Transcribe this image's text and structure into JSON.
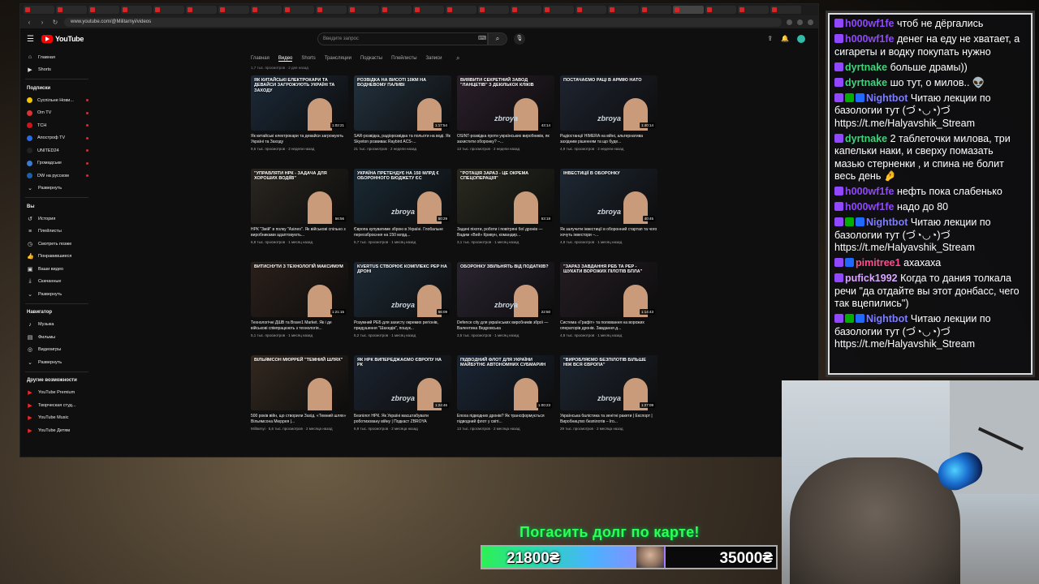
{
  "browser": {
    "url": "www.youtube.com/@Militarnyi/videos"
  },
  "youtube": {
    "logo_text": "YouTube",
    "search_placeholder": "Введите запрос",
    "sidebar": {
      "main": [
        {
          "label": "Главная",
          "icon": "home-icon"
        },
        {
          "label": "Shorts",
          "icon": "shorts-icon"
        }
      ],
      "subs_header": "Подписки",
      "subs": [
        {
          "label": "Суспільне Нови...",
          "color": "#f5c400"
        },
        {
          "label": "Om TV",
          "color": "#e03030"
        },
        {
          "label": "ТСН",
          "color": "#d01515"
        },
        {
          "label": "Апостроф TV",
          "color": "#2a6be0"
        },
        {
          "label": "UNITED24",
          "color": "#222222"
        },
        {
          "label": "Громадське",
          "color": "#3a7bd5"
        },
        {
          "label": "DW на русском",
          "color": "#1d5fa8"
        }
      ],
      "expand1": "Развернуть",
      "you_header": "Вы",
      "you": [
        {
          "label": "История",
          "icon": "history-icon"
        },
        {
          "label": "Плейлисты",
          "icon": "playlist-icon"
        },
        {
          "label": "Смотреть позже",
          "icon": "clock-icon"
        },
        {
          "label": "Понравившиеся",
          "icon": "like-icon"
        },
        {
          "label": "Ваши видео",
          "icon": "video-icon"
        },
        {
          "label": "Скачанные",
          "icon": "download-icon"
        },
        {
          "label": "Развернуть",
          "icon": "chevron-down-icon"
        }
      ],
      "nav_header": "Навигатор",
      "nav": [
        {
          "label": "Музыка",
          "icon": "music-icon"
        },
        {
          "label": "Фильмы",
          "icon": "film-icon"
        },
        {
          "label": "Видеоигры",
          "icon": "gamepad-icon"
        },
        {
          "label": "Развернуть",
          "icon": "chevron-down-icon"
        }
      ],
      "more_header": "Другие возможности",
      "more": [
        {
          "label": "YouTube Premium"
        },
        {
          "label": "Творческая студ..."
        },
        {
          "label": "YouTube Music"
        },
        {
          "label": "YouTube Детям"
        }
      ]
    },
    "channel_tabs": [
      "Главная",
      "Видео",
      "Shorts",
      "Трансляции",
      "Подкасты",
      "Плейлисты",
      "Записи"
    ],
    "prev_row_meta": [
      "1,7 тыс. просмотров · 2 дня назад",
      "",
      "",
      ""
    ],
    "rows": [
      [
        {
          "headline": "Як китайські електрокари та девайси загрожують Україні та Заходу",
          "dur": "1:02:21",
          "bg": "#1c2a3a",
          "title": "Як китайські електрокари та девайси загрожують Україні та Заходу",
          "meta": "9,6 тыс. просмотров · 2 недели назад"
        },
        {
          "headline": "Розвідка на висоті 10км на водневому паливі",
          "dur": "1:17:54",
          "bg": "#23323f",
          "title": "SAR-розвідка, радіорозвідка та польоти на воді. Як Skyeton розвиває Raybird ACS-...",
          "meta": "21 тыс. просмотров · 2 недели назад"
        },
        {
          "headline": "Виявити секретний завод \"ланцетів\" з декількох кліків",
          "dur": "43:14",
          "bg": "#2a1e2a",
          "brand": "zbroya",
          "title": "OSINT-розвідка проти українських виробників, як захистити оборонку? –...",
          "meta": "13 тыс. просмотров · 2 недели назад"
        },
        {
          "headline": "Постачаємо раці в армію НАТО",
          "dur": "1:40:14",
          "bg": "#1e2430",
          "brand": "zbroya",
          "title": "Радіостанції HIMERA на війні, альтернатива західним рішенням та що буде...",
          "meta": "4,9 тыс. просмотров · 2 недели назад"
        }
      ],
      [
        {
          "headline": "\"Управляти НРК - задача для хороших водіїв\"",
          "dur": "56:56",
          "bg": "#2b2620",
          "title": "НРК \"Змій\" в полку \"Азілео\". Як військові спільно з виробниками адаптовують...",
          "meta": "6,8 тыс. просмотров · 1 месяц назад"
        },
        {
          "headline": "Україна претендує на 150 млрд € оборонного бюджету ЄС",
          "dur": "50:29",
          "bg": "#1a2a35",
          "brand": "zbroya",
          "title": "Європа купуватиме зброю в Україні. Глобальне переозброєння на 150 млрд...",
          "meta": "5,7 тыс. просмотров · 1 месяц назад"
        },
        {
          "headline": "\"Ротація зараз - це окрема спецоперація\"",
          "dur": "53:18",
          "bg": "#2a2a20",
          "title": "Задачі піхоти, роботи і повітряні бої дронів — Вадим «Вей» Кривун, командир...",
          "meta": "3,1 тыс. просмотров · 1 месяц назад"
        },
        {
          "headline": "Інвестиції в оборонку",
          "dur": "40:45",
          "bg": "#1e2834",
          "brand": "zbroya",
          "title": "Як залучити інвестиції в оборонний стартап та чого хочуть інвестори –...",
          "meta": "4,8 тыс. просмотров · 1 месяц назад"
        }
      ],
      [
        {
          "headline": "Витиснути з технологій максимум",
          "dur": "1:21:15",
          "bg": "#2b1f1a",
          "title": "Технологічні ДШВ та Brave1 Market. Як і де військові співпрацюють з технологія...",
          "meta": "5,1 тыс. просмотров · 1 месяц назад"
        },
        {
          "headline": "Kvertus створює комплекс РЕР на дроні",
          "dur": "56:09",
          "bg": "#1d2a36",
          "brand": "zbroya",
          "title": "Розумний РЕБ для захисту окремих регіонів, придушення \"Шахедів\", пошук...",
          "meta": "5,2 тыс. просмотров · 1 месяц назад"
        },
        {
          "headline": "Оборонку звільнять від податків?",
          "dur": "22:50",
          "bg": "#2a2430",
          "brand": "zbroya",
          "title": "Defence city для українських виробників зброї — Валентина Ведровська",
          "meta": "3,5 тыс. просмотров · 1 месяц назад"
        },
        {
          "headline": "\"Зараз завдання РЕБ та РЕР - шукати ворожих пілотів БпЛА\"",
          "dur": "1:14:43",
          "bg": "#241c22",
          "title": "Система «Графіт» та полювання на ворожих операторів дронів. Завдання д...",
          "meta": "4,8 тыс. просмотров · 1 месяц назад"
        }
      ],
      [
        {
          "headline": "Вільямсон Мюррей \"Темний шлях\"",
          "dur": "",
          "bg": "#33281f",
          "title": "500 років війн, що створили Захід. «Темний шлях» Вільямсона Мюррея |...",
          "meta": "Militarnyi · 5,6 тыс. просмотров · 2 месяца назад"
        },
        {
          "headline": "Як НРК випереджаємо Європу на РК",
          "dur": "1:24:46",
          "bg": "#1c2430",
          "brand": "zbroya",
          "title": "Безпілот НРК. Як Україні масштабувати роботизовану війну | Подкаст ZBROYA",
          "meta": "6,9 тыс. просмотров · 2 месяца назад"
        },
        {
          "headline": "Підводний флот для України майбутнє автономних субмарин",
          "dur": "1:00:23",
          "bg": "#1a2636",
          "title": "Епоха підводних дронів? Як трансформується підводний флот у світі...",
          "meta": "13 тыс. просмотров · 2 месяца назад"
        },
        {
          "headline": "\"Виробляємо безпілотів більше ніж вся Європа\"",
          "dur": "1:27:09",
          "bg": "#1e2632",
          "brand": "zbroya",
          "title": "Українська балістика та зенітні ракети | Експорт | Виробництво безпілотів – Іго...",
          "meta": "29 тыс. просмотров · 2 месяца назад"
        }
      ]
    ]
  },
  "chat": [
    {
      "user": "h000wf1fe",
      "color": "#9146ff",
      "badges": [
        "b-purple"
      ],
      "text": "чтоб не дёргались"
    },
    {
      "user": "h000wf1fe",
      "color": "#9146ff",
      "badges": [
        "b-purple"
      ],
      "text": "денег на еду не хватает, а сигареты и водку покупать нужно"
    },
    {
      "user": "dyrtnake",
      "color": "#3cd67a",
      "badges": [
        "b-purple"
      ],
      "text": "больше драмы))"
    },
    {
      "user": "dyrtnake",
      "color": "#3cd67a",
      "badges": [
        "b-purple"
      ],
      "text": "шо тут, о милов.. 👽"
    },
    {
      "user": "Nightbot",
      "color": "#7c7cff",
      "badges": [
        "b-purple",
        "b-green",
        "b-blue"
      ],
      "text": "Читаю лекции по базологии тут (づ◔◡◔)づ https://t.me/Halyavshik_Stream"
    },
    {
      "user": "dyrtnake",
      "color": "#3cd67a",
      "badges": [
        "b-purple"
      ],
      "text": "2 таблеточки милова, три капельки наки, и сверху помазать мазью стерненки , и спина не болит весь день 🤌"
    },
    {
      "user": "h000wf1fe",
      "color": "#9146ff",
      "badges": [
        "b-purple"
      ],
      "text": "нефть пока слабенько"
    },
    {
      "user": "h000wf1fe",
      "color": "#9146ff",
      "badges": [
        "b-purple"
      ],
      "text": "надо до 80"
    },
    {
      "user": "Nightbot",
      "color": "#7c7cff",
      "badges": [
        "b-purple",
        "b-green",
        "b-blue"
      ],
      "text": "Читаю лекции по базологии тут (づ◔◡◔)づ https://t.me/Halyavshik_Stream"
    },
    {
      "user": "pimitree1",
      "color": "#ff4d8d",
      "badges": [
        "b-purple",
        "b-blue"
      ],
      "text": "ахахаха"
    },
    {
      "user": "pufick1992",
      "color": "#d9a7ff",
      "badges": [
        "b-purple"
      ],
      "text": "Когда то дания толкала речи \"да отдайте вы этот донбасс, чего так вцепились\")"
    },
    {
      "user": "Nightbot",
      "color": "#7c7cff",
      "badges": [
        "b-purple",
        "b-green",
        "b-blue"
      ],
      "text": "Читаю лекции по базологии тут (づ◔◡◔)づ https://t.me/Halyavshik_Stream"
    }
  ],
  "donation": {
    "title": "Погасить долг по карте!",
    "current": "21800₴",
    "goal": "35000₴",
    "progress": 0.623
  }
}
